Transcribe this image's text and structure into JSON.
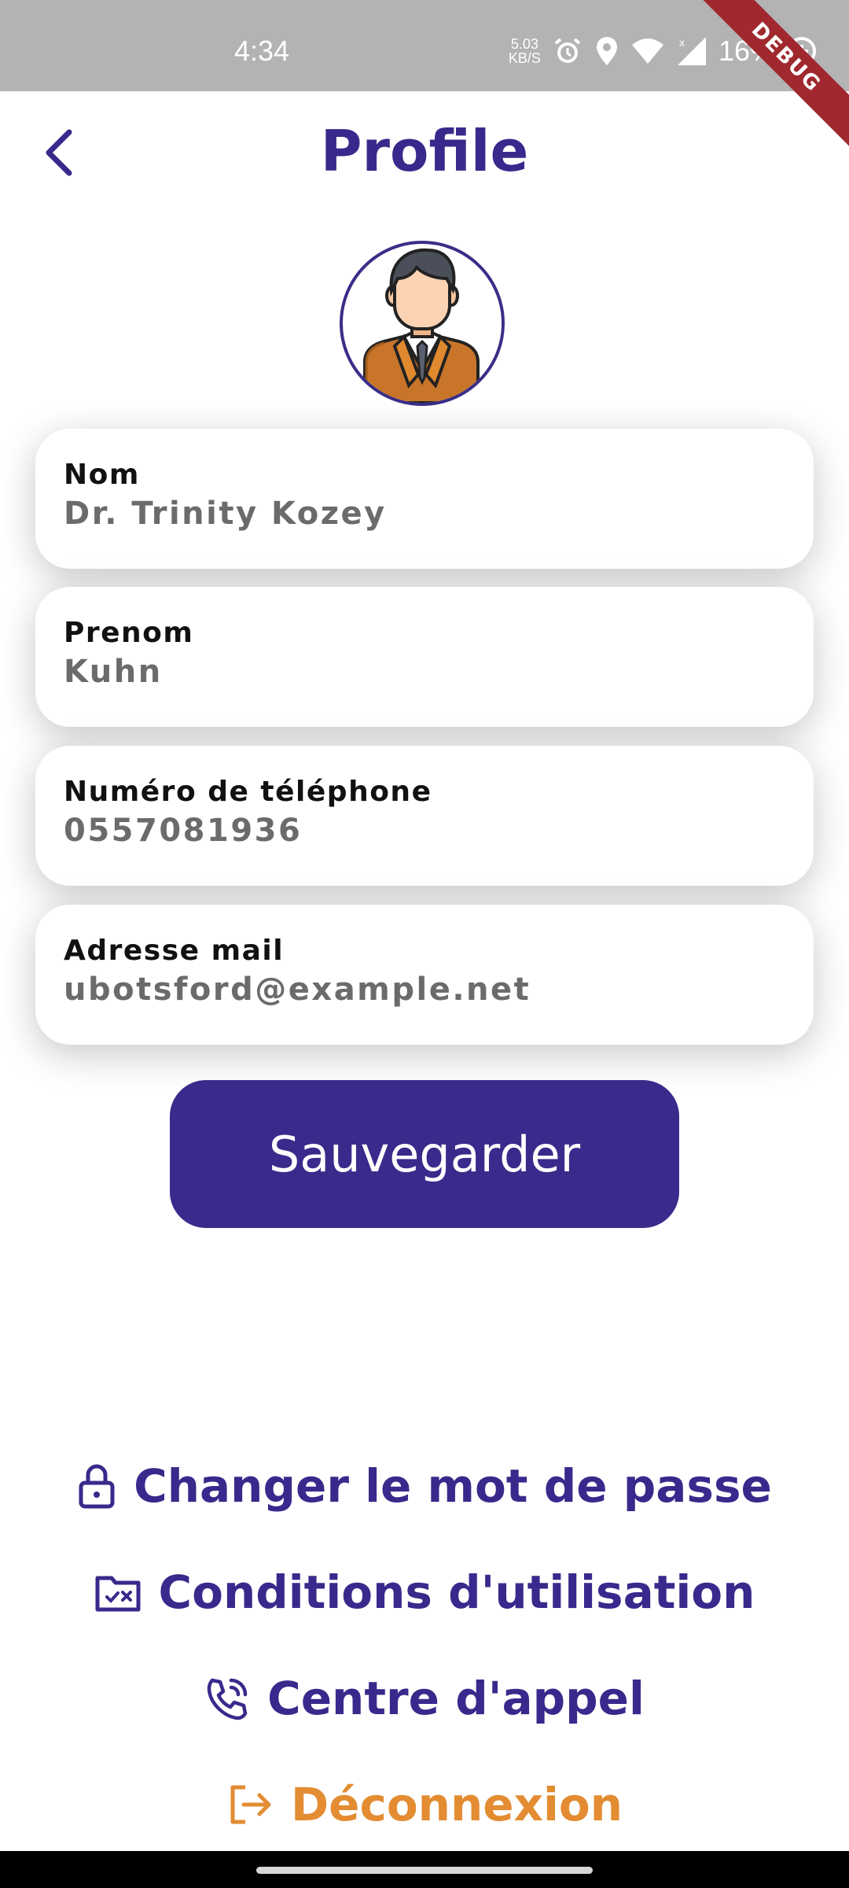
{
  "status_bar": {
    "time": "4:34",
    "net_speed_value": "5.03",
    "net_speed_unit": "KB/S",
    "battery": "16%"
  },
  "debug_banner": "DEBUG",
  "header": {
    "title": "Profile"
  },
  "fields": [
    {
      "label": "Nom",
      "value": "Dr. Trinity Kozey"
    },
    {
      "label": "Prenom",
      "value": "Kuhn"
    },
    {
      "label": "Numéro de téléphone",
      "value": "0557081936"
    },
    {
      "label": "Adresse mail",
      "value": "ubotsford@example.net"
    }
  ],
  "save_label": "Sauvegarder",
  "links": {
    "change_password": "Changer le mot de passe",
    "terms": "Conditions d'utilisation",
    "call_center": "Centre d'appel",
    "logout": "Déconnexion"
  },
  "colors": {
    "primary": "#382a8c",
    "logout": "#e38c32",
    "status_bar": "#b3b3b3"
  }
}
